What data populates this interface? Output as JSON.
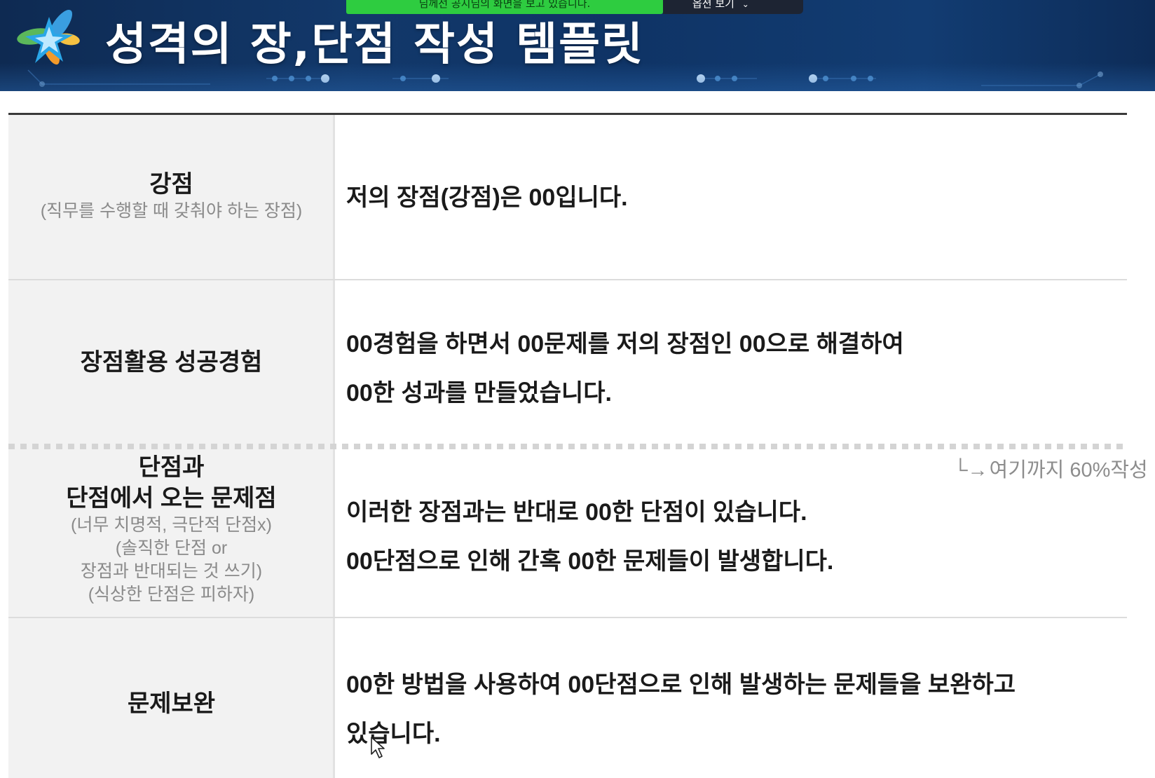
{
  "header": {
    "title": "성격의 장,단점 작성 템플릿"
  },
  "share": {
    "notice": "님께선 공지님의 화면을 보고 있습니다.",
    "options_label": "옵션 보기"
  },
  "rows": [
    {
      "label": "강점",
      "sub": [
        "(직무를 수행할 때 갖춰야 하는 장점)"
      ],
      "text": [
        "저의 장점(강점)은 00입니다."
      ]
    },
    {
      "label": "장점활용 성공경험",
      "sub": [],
      "text": [
        "00경험을 하면서 00문제를 저의 장점인 00으로 해결하여",
        "00한 성과를 만들었습니다."
      ]
    },
    {
      "label_lines": [
        "단점과",
        "단점에서 오는 문제점"
      ],
      "sub": [
        "(너무 치명적, 극단적 단점x)",
        "(솔직한 단점 or",
        "장점과 반대되는 것 쓰기)",
        "(식상한 단점은 피하자)"
      ],
      "text": [
        "이러한 장점과는 반대로 00한 단점이 있습니다.",
        "00단점으로 인해 간혹 00한 문제들이 발생합니다."
      ]
    },
    {
      "label": "문제보완",
      "sub": [],
      "text": [
        "00한 방법을 사용하여 00단점으로 인해 발생하는 문제들을 보완하고",
        "있습니다."
      ]
    }
  ],
  "note": {
    "mark": "└→",
    "text": "여기까지 60%작성"
  },
  "colors": {
    "banner": "#12386a",
    "share_bar": "#2ecc40",
    "label_bg": "#f2f2f2"
  }
}
